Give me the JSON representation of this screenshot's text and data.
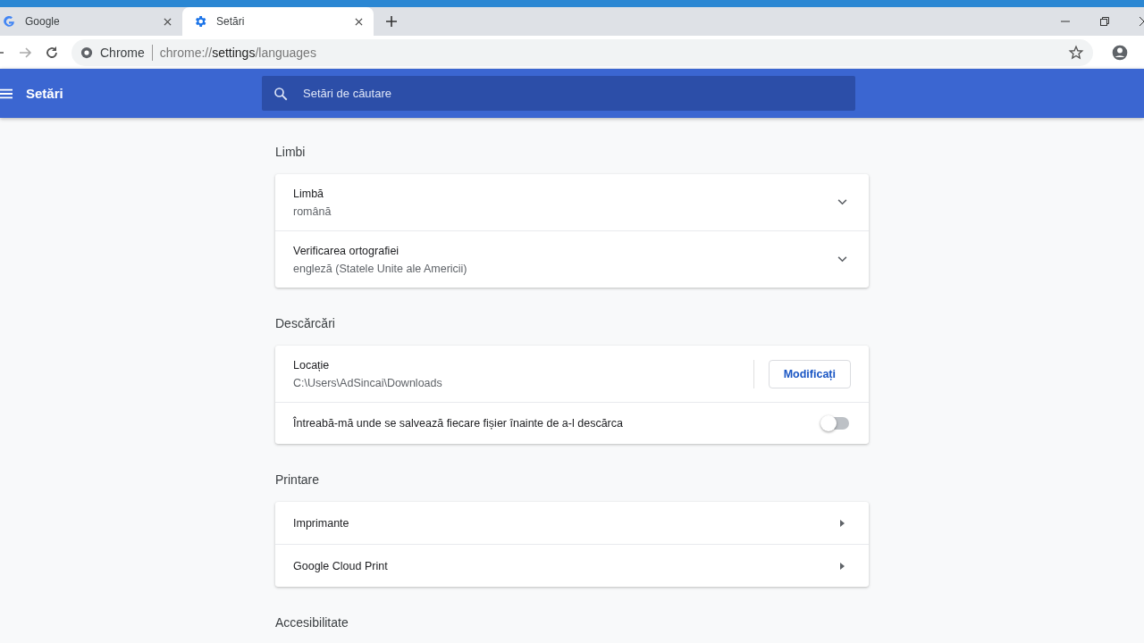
{
  "tabs": [
    {
      "title": "Google",
      "selected": false
    },
    {
      "title": "Setări",
      "selected": true
    }
  ],
  "address": {
    "site": "Chrome",
    "url_parts": [
      "chrome://",
      "settings",
      "/languages"
    ]
  },
  "header": {
    "title": "Setări",
    "search": {
      "placeholder": "Setări de căutare"
    }
  },
  "sections": [
    {
      "title": "Limbi",
      "rows": [
        {
          "kind": "expand",
          "label": "Limbă",
          "value": "română"
        },
        {
          "kind": "expand",
          "label": "Verificarea ortografiei",
          "value": "engleză (Statele Unite ale Americii)"
        }
      ]
    },
    {
      "title": "Descărcări",
      "rows": [
        {
          "kind": "button",
          "label": "Locație",
          "value": "C:\\Users\\AdSincai\\Downloads",
          "button": "Modificați"
        },
        {
          "kind": "toggle",
          "label": "Întreabă-mă unde se salvează fiecare fișier înainte de a-l descărca",
          "on": false
        }
      ]
    },
    {
      "title": "Printare",
      "rows": [
        {
          "kind": "link",
          "label": "Imprimante"
        },
        {
          "kind": "link",
          "label": "Google Cloud Print"
        }
      ]
    },
    {
      "title": "Accesibilitate"
    }
  ]
}
